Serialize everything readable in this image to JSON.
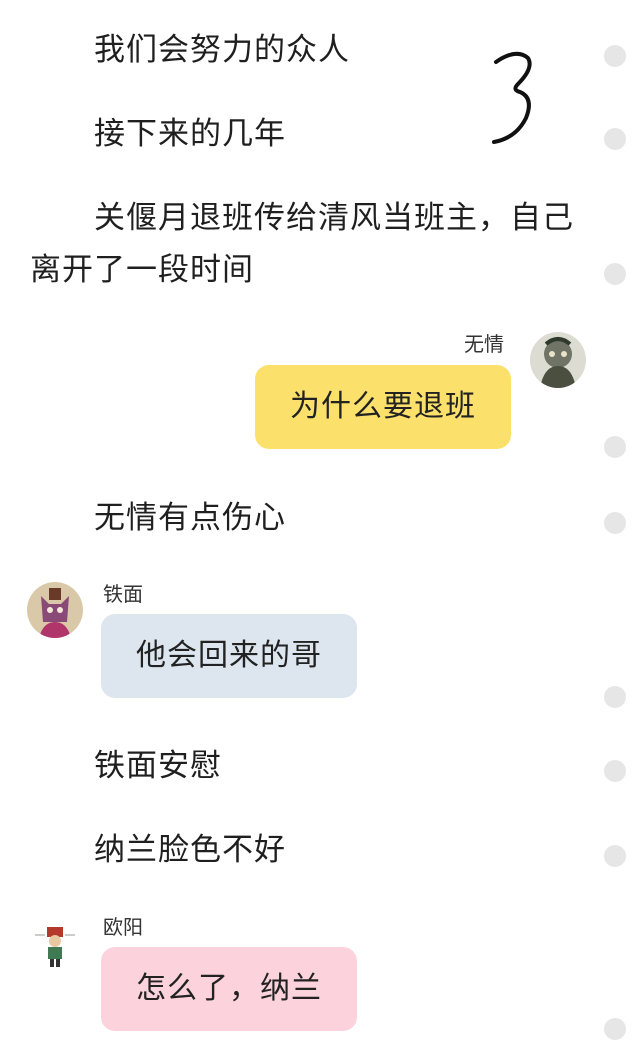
{
  "narration": [
    "我们会努力的众人",
    "接下来的几年",
    "关偃月退班传给清风当班主，自己离开了一段时间",
    "无情有点伤心",
    "铁面安慰",
    "纳兰脸色不好"
  ],
  "annotation_mark": "3",
  "messages": [
    {
      "sender": "无情",
      "text": "为什么要退班",
      "side": "right",
      "bubble_color": "#fbe06b"
    },
    {
      "sender": "铁面",
      "text": "他会回来的哥",
      "side": "left",
      "bubble_color": "#dde6ee"
    },
    {
      "sender": "欧阳",
      "text": "怎么了，纳兰",
      "side": "left",
      "bubble_color": "#fcd3dc"
    }
  ],
  "colors": {
    "dot": "#e6e6e6",
    "background": "#ffffff"
  }
}
